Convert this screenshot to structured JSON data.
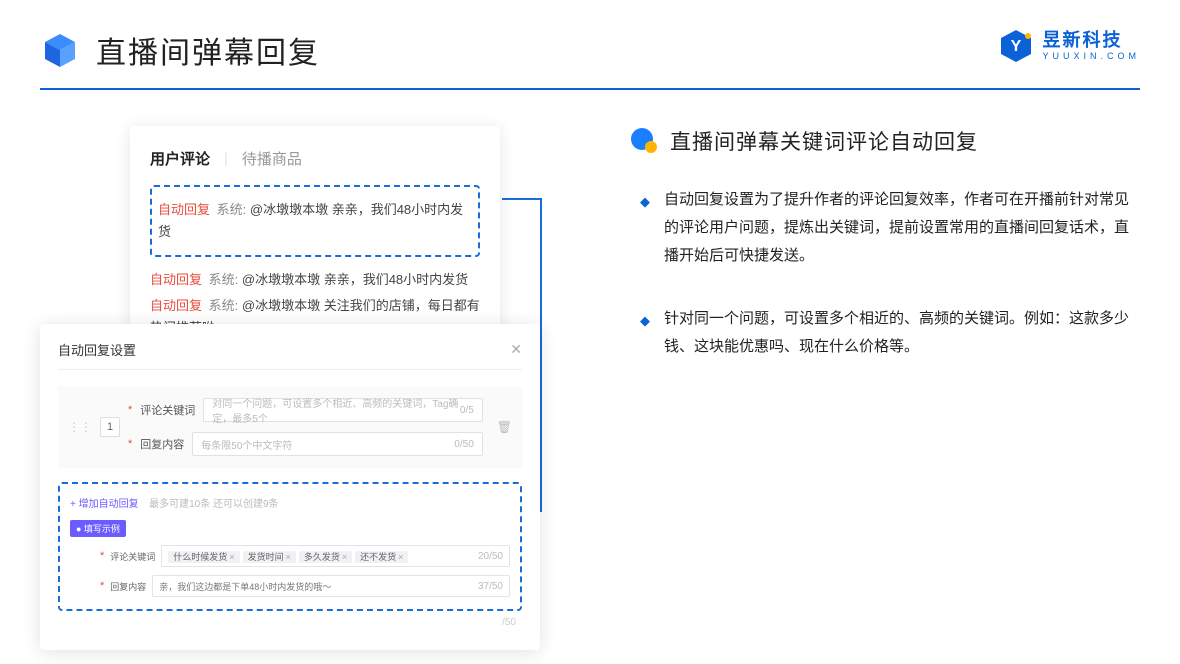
{
  "header": {
    "title": "直播间弹幕回复"
  },
  "brand": {
    "name": "昱新科技",
    "sub": "YUUXIN.COM"
  },
  "comments_panel": {
    "tab_active": "用户评论",
    "tab_other": "待播商品",
    "highlighted": {
      "tag": "自动回复",
      "sys": "系统:",
      "text": "@冰墩墩本墩 亲亲，我们48小时内发货"
    },
    "line2": {
      "tag": "自动回复",
      "sys": "系统:",
      "text": "@冰墩墩本墩 亲亲，我们48小时内发货"
    },
    "line3": {
      "tag": "自动回复",
      "sys": "系统:",
      "text": "@冰墩墩本墩 关注我们的店铺，每日都有热门推荐呦～"
    }
  },
  "settings_panel": {
    "title": "自动回复设置",
    "index": "1",
    "keyword_label": "评论关键词",
    "keyword_placeholder": "对同一个问题，可设置多个相近、高频的关键词，Tag确定，最多5个",
    "keyword_counter": "0/5",
    "reply_label": "回复内容",
    "reply_placeholder": "每条限50个中文字符",
    "reply_counter": "0/50",
    "add_link": "+ 增加自动回复",
    "add_note": "最多可建10条 还可以创建9条",
    "badge": "● 填写示例",
    "ex_keyword_label": "评论关键词",
    "ex_chips": [
      "什么时候发货",
      "发货时间",
      "多久发货",
      "还不发货"
    ],
    "ex_keyword_counter": "20/50",
    "ex_reply_label": "回复内容",
    "ex_reply_text": "亲，我们这边都是下单48小时内发货的哦～",
    "ex_reply_counter": "37/50",
    "outer_counter": "/50"
  },
  "right": {
    "title": "直播间弹幕关键词评论自动回复",
    "bullets": [
      "自动回复设置为了提升作者的评论回复效率，作者可在开播前针对常见的评论用户问题，提炼出关键词，提前设置常用的直播间回复话术，直播开始后可快捷发送。",
      "针对同一个问题，可设置多个相近的、高频的关键词。例如：这款多少钱、这块能优惠吗、现在什么价格等。"
    ]
  }
}
